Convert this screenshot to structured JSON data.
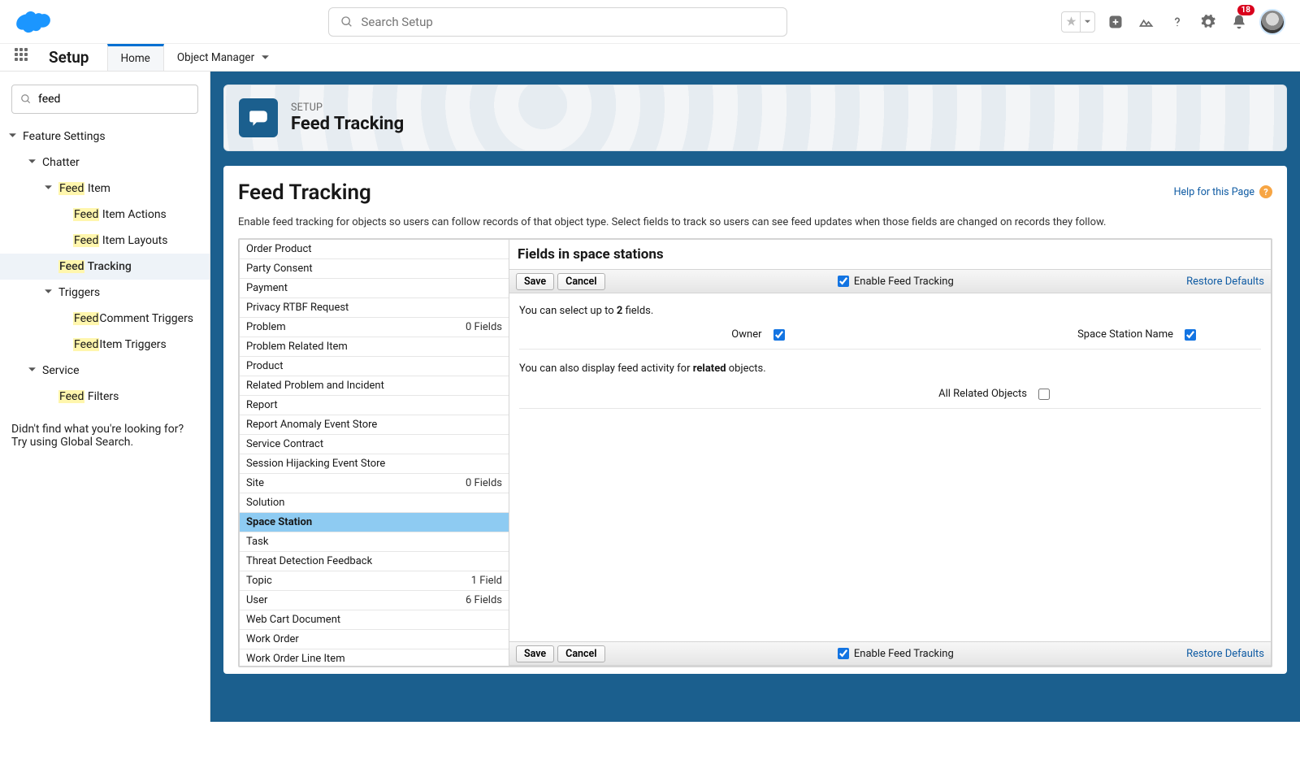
{
  "header": {
    "search_placeholder": "Search Setup",
    "notification_count": "18"
  },
  "secnav": {
    "title": "Setup",
    "tab_home": "Home",
    "tab_obj": "Object Manager"
  },
  "sidebar": {
    "search_value": "feed",
    "feature_settings": "Feature Settings",
    "chatter": "Chatter",
    "feed_item": "Item",
    "feed_item_actions": "Item Actions",
    "feed_item_layouts": "Item Layouts",
    "feed_tracking": "Tracking",
    "triggers": "Triggers",
    "feed_comment_triggers": "Comment Triggers",
    "feed_item_triggers": "Item Triggers",
    "service": "Service",
    "feed_filters": "Filters",
    "not_found_1": "Didn't find what you're looking for?",
    "not_found_2": "Try using Global Search."
  },
  "pagehead": {
    "eyebrow": "SETUP",
    "title": "Feed Tracking"
  },
  "panel": {
    "title": "Feed Tracking",
    "help": "Help for this Page",
    "desc": "Enable feed tracking for objects so users can follow records of that object type. Select fields to track so users can see feed updates when those fields are changed on records they follow."
  },
  "objects": [
    {
      "name": "Order Product"
    },
    {
      "name": "Party Consent"
    },
    {
      "name": "Payment"
    },
    {
      "name": "Privacy RTBF Request"
    },
    {
      "name": "Problem",
      "meta": "0 Fields"
    },
    {
      "name": "Problem Related Item"
    },
    {
      "name": "Product"
    },
    {
      "name": "Related Problem and Incident"
    },
    {
      "name": "Report"
    },
    {
      "name": "Report Anomaly Event Store"
    },
    {
      "name": "Service Contract"
    },
    {
      "name": "Session Hijacking Event Store"
    },
    {
      "name": "Site",
      "meta": "0 Fields"
    },
    {
      "name": "Solution"
    },
    {
      "name": "Space Station",
      "selected": true
    },
    {
      "name": "Task"
    },
    {
      "name": "Threat Detection Feedback"
    },
    {
      "name": "Topic",
      "meta": "1 Field"
    },
    {
      "name": "User",
      "meta": "6 Fields"
    },
    {
      "name": "Web Cart Document"
    },
    {
      "name": "Work Order"
    },
    {
      "name": "Work Order Line Item"
    }
  ],
  "fields": {
    "heading": "Fields in space stations",
    "save": "Save",
    "cancel": "Cancel",
    "enable_label": "Enable Feed Tracking",
    "restore": "Restore Defaults",
    "select_prefix": "You can select up to ",
    "select_count": "2",
    "select_suffix": " fields.",
    "owner": "Owner",
    "station_name": "Space Station Name",
    "related_prefix": "You can also display feed activity for ",
    "related_bold": "related",
    "related_suffix": " objects.",
    "all_related": "All Related Objects"
  }
}
